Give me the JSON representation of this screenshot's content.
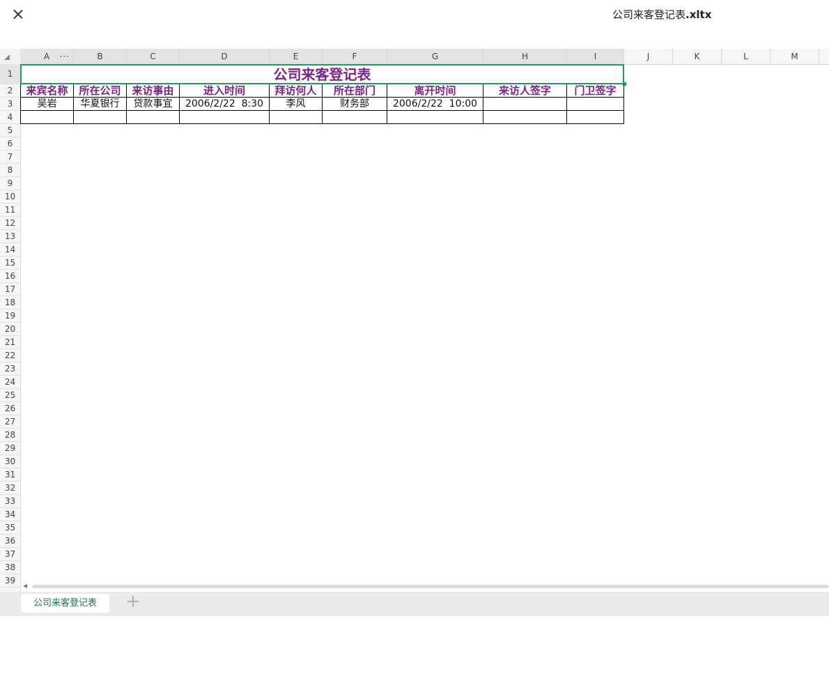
{
  "window": {
    "title_name": "公司来客登记表",
    "title_ext": ".xltx",
    "close_icon": "close-icon"
  },
  "columns": [
    "A",
    "B",
    "C",
    "D",
    "E",
    "F",
    "G",
    "H",
    "I",
    "J",
    "K",
    "L",
    "M"
  ],
  "col_menu_glyph": "···",
  "rows": [
    "1",
    "2",
    "3",
    "4",
    "5",
    "6",
    "7",
    "8",
    "9",
    "10",
    "11",
    "12",
    "13",
    "14",
    "15",
    "16",
    "17",
    "18",
    "19",
    "20",
    "21",
    "22",
    "23",
    "24",
    "25",
    "26",
    "27",
    "28",
    "29",
    "30",
    "31",
    "32",
    "33",
    "34",
    "35",
    "36",
    "37",
    "38",
    "39"
  ],
  "table": {
    "title": "公司来客登记表",
    "headers": [
      "来宾名称",
      "所在公司",
      "来访事由",
      "进入时间",
      "拜访何人",
      "所在部门",
      "离开时间",
      "来访人签字",
      "门卫签字"
    ],
    "records": [
      [
        "吴岩",
        "华夏银行",
        "贷款事宜",
        "2006/2/22  8:30",
        "李风",
        "财务部",
        "2006/2/22  10:00",
        "",
        ""
      ],
      [
        "",
        "",
        "",
        "",
        "",
        "",
        "",
        "",
        ""
      ]
    ]
  },
  "colors": {
    "title_text": "#7f1f8a",
    "selection_border": "#1e9e5a",
    "sheet_tab_text": "#1a7a4a"
  },
  "sheet_tabs": [
    {
      "label": "公司来客登记表",
      "active": true
    }
  ],
  "add_sheet_icon": "plus-icon"
}
